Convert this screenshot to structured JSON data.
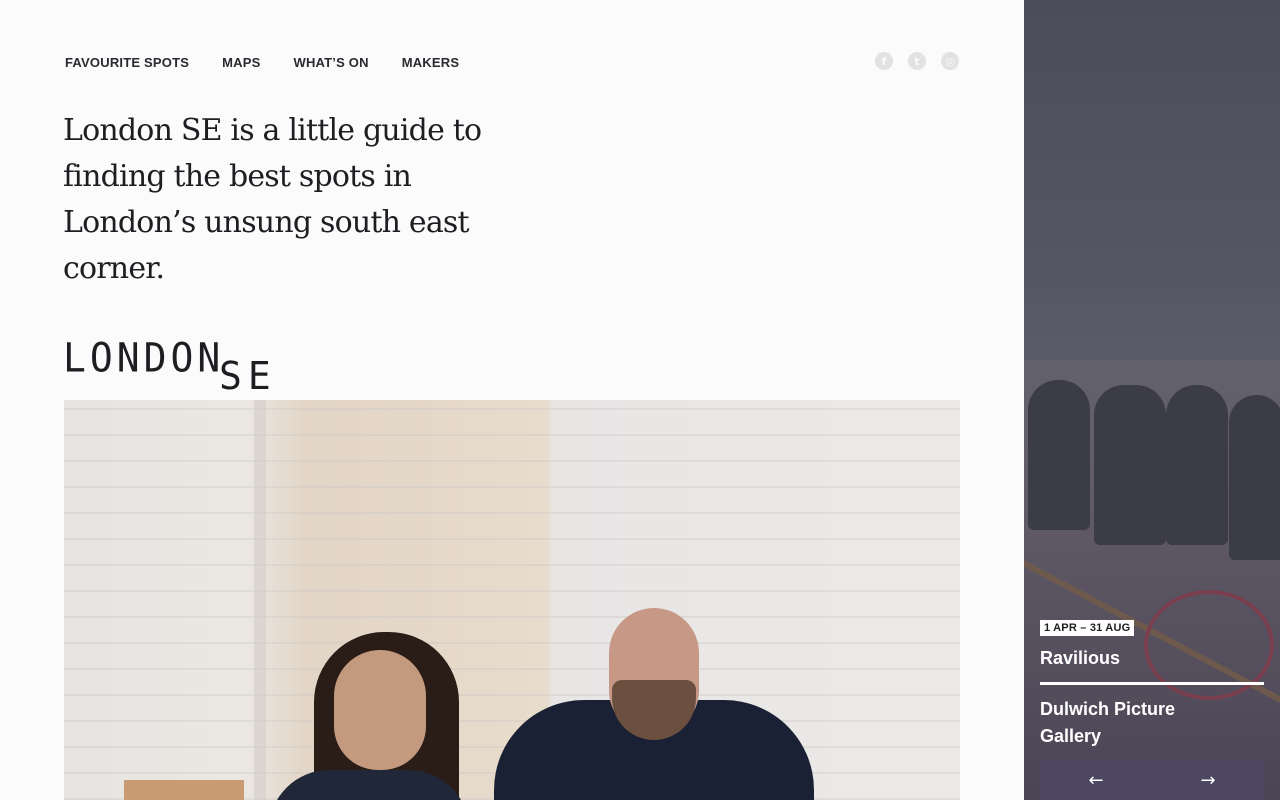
{
  "nav": {
    "items": [
      {
        "label": "FAVOURITE SPOTS"
      },
      {
        "label": "MAPS"
      },
      {
        "label": "WHAT’S ON"
      },
      {
        "label": "MAKERS"
      }
    ]
  },
  "social": {
    "icons": [
      "facebook-icon",
      "twitter-icon",
      "instagram-icon"
    ],
    "glyphs": [
      "f",
      "t",
      "◎"
    ]
  },
  "intro": {
    "text": "London SE is a little guide to finding the best spots in London’s unsung south east corner."
  },
  "logo": {
    "word1": "LONDON",
    "word2": "SE"
  },
  "event": {
    "dates": "1 APR – 31 AUG",
    "title": "Ravilious",
    "venue": "Dulwich Picture Gallery",
    "prev_arrow": "←",
    "next_arrow": "→"
  },
  "colors": {
    "background": "#fbfbfb",
    "text": "#1d1d22",
    "side_panel": "#555563",
    "arrow_bar": "#4d4761"
  }
}
